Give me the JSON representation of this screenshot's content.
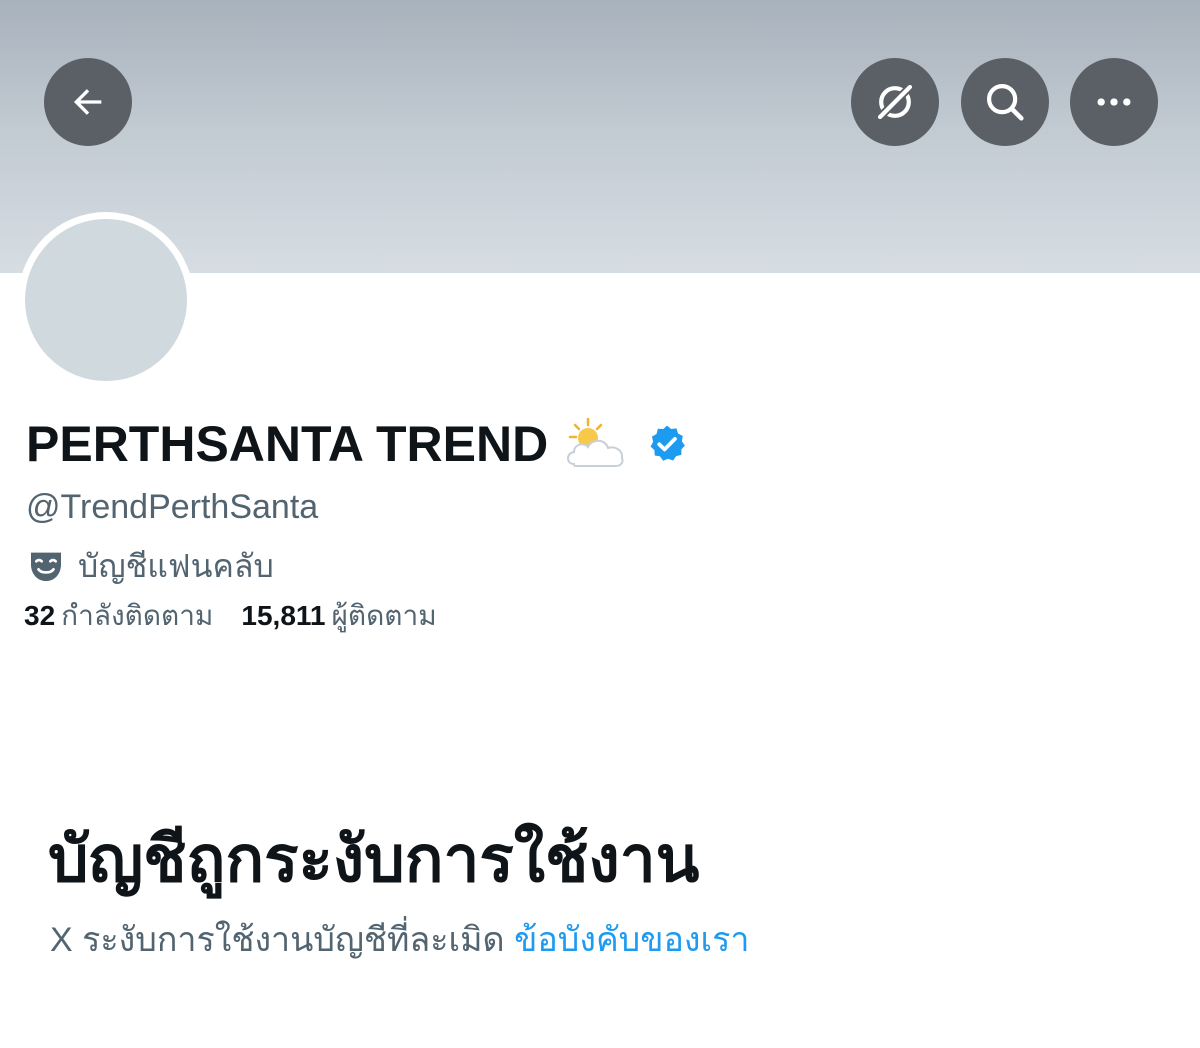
{
  "header": {
    "back_icon": "arrow-left-icon",
    "grok_icon": "grok-slash-circle-icon",
    "search_icon": "search-icon",
    "more_icon": "more-dots-icon"
  },
  "profile": {
    "display_name": "PERTHSANTA TREND",
    "name_emoji": "sun-behind-cloud-emoji",
    "verified_icon": "verified-badge-icon",
    "handle": "@TrendPerthSanta",
    "category_icon": "theater-mask-icon",
    "category": "บัญชีแฟนคลับ",
    "following_count": "32",
    "following_label": "กำลังติดตาม",
    "followers_count": "15,811",
    "followers_label": "ผู้ติดตาม"
  },
  "suspension": {
    "title": "บัญชีถูกระงับการใช้งาน",
    "description": "X ระงับการใช้งานบัญชีที่ละเมิด",
    "link_text": "ข้อบังคับของเรา"
  },
  "colors": {
    "accent": "#1d9bf0",
    "secondary_text": "#536471",
    "banner": "#c3cbd3",
    "avatar_placeholder": "#cfd9de",
    "header_button": "#5a6066"
  }
}
